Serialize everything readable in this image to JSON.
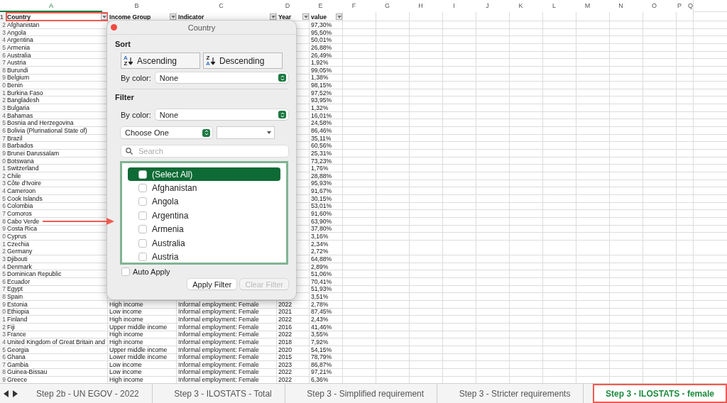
{
  "column_headers": [
    {
      "label": "A",
      "selected": true
    },
    {
      "label": "B",
      "selected": false
    },
    {
      "label": "C",
      "selected": false
    },
    {
      "label": "D",
      "selected": false
    },
    {
      "label": "E",
      "selected": false
    },
    {
      "label": "F",
      "selected": false
    },
    {
      "label": "G",
      "selected": false
    },
    {
      "label": "H",
      "selected": false
    },
    {
      "label": "I",
      "selected": false
    },
    {
      "label": "J",
      "selected": false
    },
    {
      "label": "K",
      "selected": false
    },
    {
      "label": "L",
      "selected": false
    },
    {
      "label": "M",
      "selected": false
    },
    {
      "label": "N",
      "selected": false
    },
    {
      "label": "O",
      "selected": false
    },
    {
      "label": "P",
      "selected": false
    },
    {
      "label": "Q",
      "selected": false
    }
  ],
  "header_row": {
    "row_label": "1",
    "cells": [
      {
        "text": "Country",
        "highlighted": true
      },
      {
        "text": "Income Group",
        "highlighted": false
      },
      {
        "text": "Indicator",
        "highlighted": false
      },
      {
        "text": "Year",
        "highlighted": false
      },
      {
        "text": "value",
        "highlighted": false
      }
    ]
  },
  "rows": [
    {
      "row_label": "2",
      "country": "Afghanistan",
      "value": "97,30%"
    },
    {
      "row_label": "3",
      "country": "Angola",
      "value": "95,50%"
    },
    {
      "row_label": "4",
      "country": "Argentina",
      "value": "50,01%"
    },
    {
      "row_label": "5",
      "country": "Armenia",
      "value": "26,88%"
    },
    {
      "row_label": "6",
      "country": "Australia",
      "value": "26,49%"
    },
    {
      "row_label": "7",
      "country": "Austria",
      "value": "1,92%"
    },
    {
      "row_label": "8",
      "country": "Burundi",
      "value": "99,05%"
    },
    {
      "row_label": "9",
      "country": "Belgium",
      "value": "1,38%"
    },
    {
      "row_label": "0",
      "country": "Benin",
      "value": "98,15%"
    },
    {
      "row_label": "1",
      "country": "Burkina Faso",
      "value": "97,52%"
    },
    {
      "row_label": "2",
      "country": "Bangladesh",
      "value": "93,95%"
    },
    {
      "row_label": "3",
      "country": "Bulgaria",
      "value": "1,32%"
    },
    {
      "row_label": "4",
      "country": "Bahamas",
      "value": "16,01%"
    },
    {
      "row_label": "5",
      "country": "Bosnia and Herzegovina",
      "value": "24,58%"
    },
    {
      "row_label": "6",
      "country": "Bolivia (Plurinational State of)",
      "value": "86,46%"
    },
    {
      "row_label": "7",
      "country": "Brazil",
      "value": "35,11%"
    },
    {
      "row_label": "8",
      "country": "Barbados",
      "value": "60,56%"
    },
    {
      "row_label": "9",
      "country": "Brunei Darussalam",
      "value": "25,31%"
    },
    {
      "row_label": "0",
      "country": "Botswana",
      "value": "73,23%"
    },
    {
      "row_label": "1",
      "country": "Switzerland",
      "value": "1,76%"
    },
    {
      "row_label": "2",
      "country": "Chile",
      "value": "28,88%"
    },
    {
      "row_label": "3",
      "country": "Côte d'Ivoire",
      "value": "95,93%"
    },
    {
      "row_label": "4",
      "country": "Cameroon",
      "value": "91,67%"
    },
    {
      "row_label": "5",
      "country": "Cook Islands",
      "value": "30,15%"
    },
    {
      "row_label": "6",
      "country": "Colombia",
      "value": "53,01%"
    },
    {
      "row_label": "7",
      "country": "Comoros",
      "value": "91,60%"
    },
    {
      "row_label": "8",
      "country": "Cabo Verde",
      "value": "63,90%",
      "arrow": true
    },
    {
      "row_label": "9",
      "country": "Costa Rica",
      "value": "37,80%"
    },
    {
      "row_label": "0",
      "country": "Cyprus",
      "value": "3,16%"
    },
    {
      "row_label": "1",
      "country": "Czechia",
      "value": "2,34%"
    },
    {
      "row_label": "2",
      "country": "Germany",
      "value": "2,72%"
    },
    {
      "row_label": "3",
      "country": "Djibouti",
      "value": "64,88%"
    },
    {
      "row_label": "4",
      "country": "Denmark",
      "value": "2,89%"
    },
    {
      "row_label": "5",
      "country": "Dominican Republic",
      "value": "51,06%"
    },
    {
      "row_label": "6",
      "country": "Ecuador",
      "value": "70,41%"
    },
    {
      "row_label": "7",
      "country": "Egypt",
      "value": "51,93%"
    },
    {
      "row_label": "8",
      "country": "Spain",
      "value": "3,51%"
    },
    {
      "row_label": "9",
      "country": "Estonia",
      "income_group": "High income",
      "indicator": "Informal employment: Female",
      "year": "2022",
      "value": "2,78%"
    },
    {
      "row_label": "0",
      "country": "Ethiopia",
      "income_group": "Low income",
      "indicator": "Informal employment: Female",
      "year": "2021",
      "value": "87,45%"
    },
    {
      "row_label": "1",
      "country": "Finland",
      "income_group": "High income",
      "indicator": "Informal employment: Female",
      "year": "2022",
      "value": "2,43%"
    },
    {
      "row_label": "2",
      "country": "Fiji",
      "income_group": "Upper middle income",
      "indicator": "Informal employment: Female",
      "year": "2016",
      "value": "41,46%"
    },
    {
      "row_label": "3",
      "country": "France",
      "income_group": "High income",
      "indicator": "Informal employment: Female",
      "year": "2022",
      "value": "3,55%"
    },
    {
      "row_label": "4",
      "country": "United Kingdom of Great Britain and",
      "income_group": "High income",
      "indicator": "Informal employment: Female",
      "year": "2018",
      "value": "7,92%"
    },
    {
      "row_label": "5",
      "country": "Georgia",
      "income_group": "Upper middle income",
      "indicator": "Informal employment: Female",
      "year": "2020",
      "value": "54,15%"
    },
    {
      "row_label": "6",
      "country": "Ghana",
      "income_group": "Lower middle income",
      "indicator": "Informal employment: Female",
      "year": "2015",
      "value": "78,79%"
    },
    {
      "row_label": "7",
      "country": "Gambia",
      "income_group": "Low income",
      "indicator": "Informal employment: Female",
      "year": "2023",
      "value": "86,87%"
    },
    {
      "row_label": "8",
      "country": "Guinea-Bissau",
      "income_group": "Low income",
      "indicator": "Informal employment: Female",
      "year": "2022",
      "value": "97,21%"
    },
    {
      "row_label": "9",
      "country": "Greece",
      "income_group": "High income",
      "indicator": "Informal employment: Female",
      "year": "2022",
      "value": "6,36%"
    }
  ],
  "filter_popup": {
    "title": "Country",
    "sort_label": "Sort",
    "sort_buttons": [
      {
        "kind": "ascending",
        "label": "Ascending",
        "top_letter": "A",
        "bottom_letter": "Z"
      },
      {
        "kind": "descending",
        "label": "Descending",
        "top_letter": "Z",
        "bottom_letter": "A"
      }
    ],
    "sort_by_color": {
      "label": "By color:",
      "value": "None"
    },
    "filter_label": "Filter",
    "filter_by_color": {
      "label": "By color:",
      "value": "None"
    },
    "condition": {
      "value": "Choose One"
    },
    "search": {
      "placeholder": "Search"
    },
    "items": [
      {
        "label": "(Select All)",
        "checked": false,
        "selected": true
      },
      {
        "label": "Afghanistan",
        "checked": false,
        "selected": false
      },
      {
        "label": "Angola",
        "checked": false,
        "selected": false
      },
      {
        "label": "Argentina",
        "checked": false,
        "selected": false
      },
      {
        "label": "Armenia",
        "checked": false,
        "selected": false
      },
      {
        "label": "Australia",
        "checked": false,
        "selected": false
      },
      {
        "label": "Austria",
        "checked": false,
        "selected": false
      }
    ],
    "auto_apply": {
      "label": "Auto Apply",
      "checked": false
    },
    "buttons": [
      {
        "label": "Apply Filter",
        "disabled": false
      },
      {
        "label": "Clear Filter",
        "disabled": true
      }
    ]
  },
  "sheet_tabs": [
    {
      "label": "Step 2b - UN EGOV - 2022",
      "selected": false,
      "highlighted": false
    },
    {
      "label": "Step 3 - ILOSTATS - Total",
      "selected": false,
      "highlighted": false
    },
    {
      "label": "Step 3 - Simplified requirement",
      "selected": false,
      "highlighted": false
    },
    {
      "label": "Step 3 - Stricter requirements",
      "selected": false,
      "highlighted": false
    },
    {
      "label": "Step 3 - ILOSTATS - female",
      "selected": true,
      "highlighted": true
    }
  ]
}
